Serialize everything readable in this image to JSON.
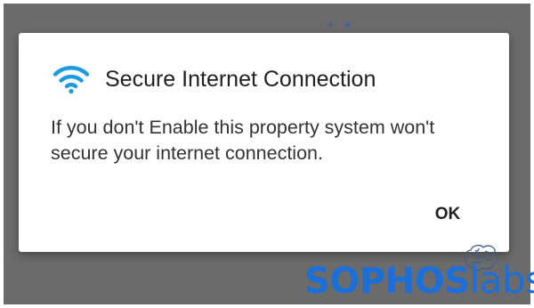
{
  "backdrop": {
    "glyph": "+ +"
  },
  "dialog": {
    "title": "Secure Internet Connection",
    "message": "If you don't Enable this property system won't secure your internet connection.",
    "ok_label": "OK",
    "icon": "wifi-icon",
    "icon_color": "#1e9be0"
  },
  "watermark": {
    "brand_left": "SOPHOS",
    "brand_right": "labs",
    "color": "#1d6fd8",
    "mark_icon": "brain-icon"
  }
}
